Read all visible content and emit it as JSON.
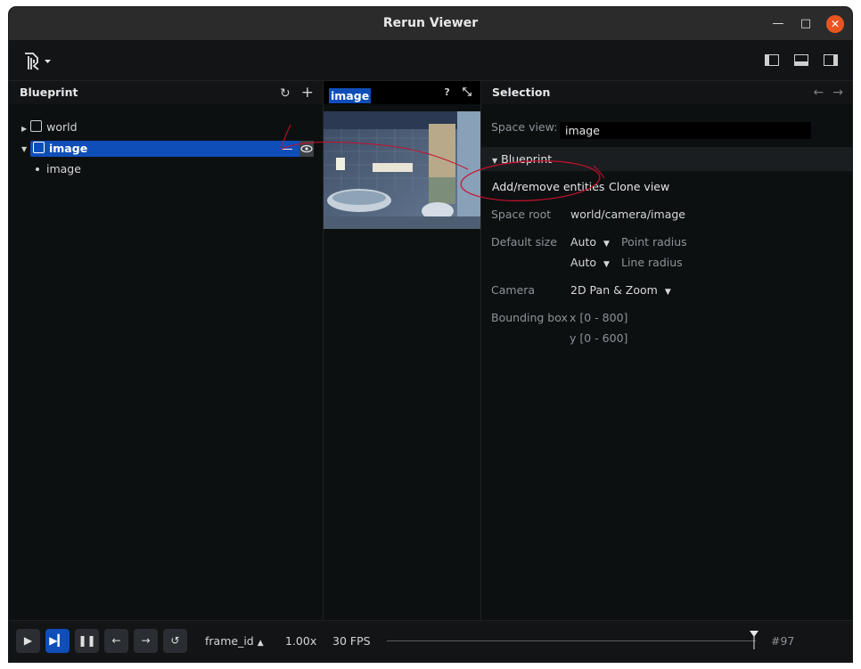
{
  "window": {
    "title": "Rerun Viewer",
    "controls": [
      "—",
      "□",
      "✕"
    ]
  },
  "blueprint_panel": {
    "title": "Blueprint",
    "items": [
      {
        "label": "world",
        "expanded": false,
        "selected": false
      },
      {
        "label": "image",
        "expanded": true,
        "selected": true
      },
      {
        "label": "image",
        "child": true
      }
    ],
    "row_actions": {
      "remove": "—"
    }
  },
  "space_view": {
    "tab_label": "image",
    "help": "?"
  },
  "selection_panel": {
    "title": "Selection",
    "space_view_label": "Space view:",
    "space_view_value": "image",
    "section_title": "Blueprint",
    "add_remove_label": "Add/remove entities",
    "clone_label": "Clone view",
    "space_root_label": "Space root",
    "space_root_value": "world/camera/image",
    "default_size_label": "Default size",
    "point_radius_value": "Auto",
    "point_radius_label": "Point radius",
    "line_radius_value": "Auto",
    "line_radius_label": "Line radius",
    "camera_label": "Camera",
    "camera_value": "2D Pan & Zoom",
    "bounding_box_label": "Bounding box",
    "bbox_x": "x [0 - 800]",
    "bbox_y": "y [0 - 600]"
  },
  "timeline": {
    "timeline_name": "frame_id",
    "speed": "1.00x",
    "fps": "30 FPS",
    "frame": "#97",
    "position": 0.996
  },
  "colors": {
    "accent": "#0f4eb8",
    "close": "#e95420",
    "annotation": "#c8102e"
  }
}
